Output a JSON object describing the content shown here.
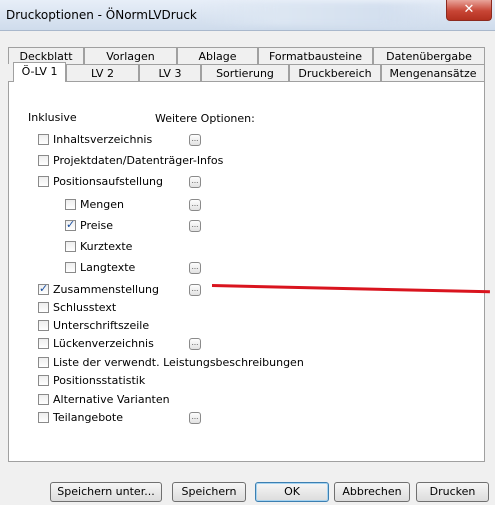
{
  "window": {
    "title": "Druckoptionen - ÖNormLVDruck",
    "close_glyph": "✕"
  },
  "tabs_row1": [
    {
      "label": "Deckblatt"
    },
    {
      "label": "Vorlagen"
    },
    {
      "label": "Ablage"
    },
    {
      "label": "Formatbausteine"
    },
    {
      "label": "Datenübergabe"
    }
  ],
  "tabs_row2": [
    {
      "label": "Ö-LV 1"
    },
    {
      "label": "LV 2"
    },
    {
      "label": "LV 3"
    },
    {
      "label": "Sortierung"
    },
    {
      "label": "Druckbereich"
    },
    {
      "label": "Mengenansätze"
    }
  ],
  "panel": {
    "inklusive_label": "Inklusive",
    "weitere_label": "Weitere Optionen:",
    "options": [
      {
        "label": "Inhaltsverzeichnis",
        "checked": false,
        "has_options": true
      },
      {
        "label": "Projektdaten/Datenträger-Infos",
        "checked": false,
        "has_options": false
      },
      {
        "label": "Positionsaufstellung",
        "checked": false,
        "has_options": true
      },
      {
        "label": "Mengen",
        "checked": false,
        "has_options": true
      },
      {
        "label": "Preise",
        "checked": true,
        "has_options": true
      },
      {
        "label": "Kurztexte",
        "checked": false,
        "has_options": false
      },
      {
        "label": "Langtexte",
        "checked": false,
        "has_options": true
      },
      {
        "label": "Zusammenstellung",
        "checked": true,
        "has_options": true
      },
      {
        "label": "Schlusstext",
        "checked": false,
        "has_options": false
      },
      {
        "label": "Unterschriftszeile",
        "checked": false,
        "has_options": false
      },
      {
        "label": "Lückenverzeichnis",
        "checked": false,
        "has_options": true
      },
      {
        "label": "Liste der verwendt. Leistungsbeschreibungen",
        "checked": false,
        "has_options": false
      },
      {
        "label": "Positionsstatistik",
        "checked": false,
        "has_options": false
      },
      {
        "label": "Alternative Varianten",
        "checked": false,
        "has_options": false
      },
      {
        "label": "Teilangebote",
        "checked": false,
        "has_options": true
      }
    ],
    "ellipsis": "..."
  },
  "buttons": {
    "save_as": "Speichern unter...",
    "save": "Speichern",
    "ok": "OK",
    "cancel": "Abbrechen",
    "print": "Drucken"
  },
  "checkmark": "✓",
  "colors": {
    "annotation_line": "#d9141e",
    "close_button": "#c74535"
  }
}
